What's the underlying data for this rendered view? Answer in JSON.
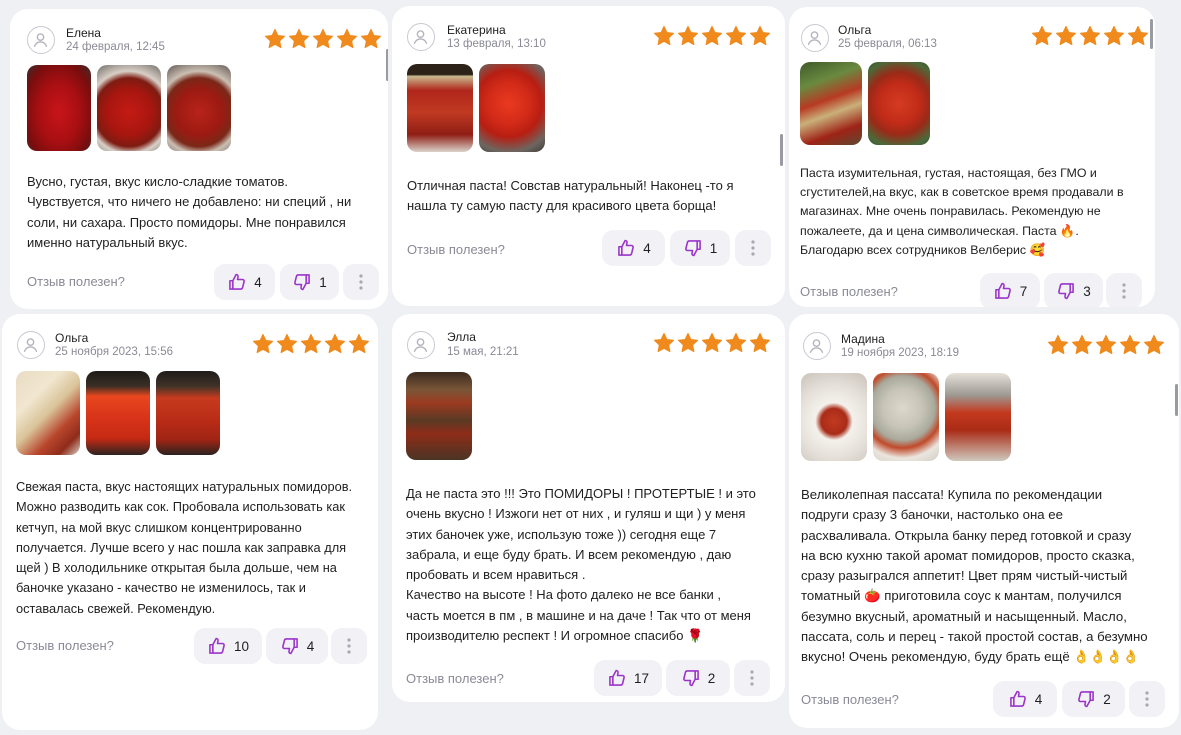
{
  "colors": {
    "star": "#f08a1d",
    "accent": "#9b34c9",
    "muted": "#8a8a96",
    "button_bg": "#f1f1f6"
  },
  "reviews": [
    {
      "name": "Елена",
      "date": "24 февраля, 12:45",
      "rating": 5,
      "photos": [
        "tomato-paste-spoon-photo",
        "paste-jar-open-photo",
        "paste-jar-open-photo"
      ],
      "text": "Вусно, густая, вкус кисло-сладкие томатов.\nЧувствуется, что ничего не добавлено: ни специй , ни\nсоли, ни сахара. Просто помидоры. Мне понравился\nименно натуральный вкус.",
      "helpful_label": "Отзыв полезен?",
      "likes": "4",
      "dislikes": "1"
    },
    {
      "name": "Екатерина",
      "date": "13 февраля, 13:10",
      "rating": 5,
      "photos": [
        "passata-jar-photo",
        "paste-jar-open-photo"
      ],
      "text": "Отличная паста! Совстав натуральный! Наконец -то я\nнашла ту самую пасту для красивого цвета борща!",
      "helpful_label": "Отзыв полезен?",
      "likes": "4",
      "dislikes": "1"
    },
    {
      "name": "Ольга",
      "date": "25 февраля, 06:13",
      "rating": 5,
      "photos": [
        "passata-jar-in-hand-photo",
        "paste-jar-open-photo"
      ],
      "text": "Паста изумительная, густая, настоящая, без ГМО и\nсгустителей,на вкус, как в советское время продавали в\nмагазинах. Мне очень понравилась. Рекомендую не\nпожалеете, да и цена символическая. Паста 🔥.\nБлагодарю всех сотрудников Велберис 🥰",
      "helpful_label": "Отзыв полезен?",
      "likes": "7",
      "dislikes": "3"
    },
    {
      "name": "Ольга",
      "date": "25 ноября 2023, 15:56",
      "rating": 5,
      "photos": [
        "pasta-dish-photo",
        "passata-jar-photo",
        "passata-jar-photo"
      ],
      "text": "Свежая паста, вкус настоящих натуральных помидоров.\nМожно разводить как сок. Пробовала использовать как\nкетчуп, на мой вкус слишком концентрированно\nполучается. Лучше всего у нас пошла как заправка для\nщей ) В холодильнике открытая была дольше, чем на\nбаночке указано - качество не изменилось, так и\nоставалась свежей. Рекомендую.",
      "helpful_label": "Отзыв полезен?",
      "likes": "10",
      "dislikes": "4"
    },
    {
      "name": "Элла",
      "date": "15 мая, 21:21",
      "rating": 5,
      "photos": [
        "jars-on-shelf-photo"
      ],
      "text": "Да не паста это !!! Это ПОМИДОРЫ ! ПРОТЕРТЫЕ ! и это\nочень вкусно ! Изжоги нет от них , и гуляш и щи ) у меня\nэтих баночек уже, использую тоже  )) сегодня еще 7\nзабрала, и еще буду брать. И всем рекомендую , даю\nпробовать и всем нравиться .\nКачество на высоте ! На фото далеко не все банки ,\nчасть моется в пм , в машине и на даче ! Так что от меня\nпроизводителю респект ! И огромное спасибо 🌹",
      "helpful_label": "Отзыв полезен?",
      "likes": "17",
      "dislikes": "2"
    },
    {
      "name": "Мадина",
      "date": "19 ноября 2023, 18:19",
      "rating": 5,
      "photos": [
        "sauce-bowl-photo",
        "manti-with-sauce-photo",
        "three-jars-photo"
      ],
      "text": "Великолепная пассата! Купила по рекомендации\nподруги сразу 3 баночки, настолько она ее\nрасхваливала. Открыла банку перед готовкой и сразу\nна всю кухню такой аромат помидоров, просто сказка,\nсразу разыгрался аппетит! Цвет прям чистый-чистый\nтоматный 🍅 приготовила соус к мантам, получился\nбезумно вкусный, ароматный и насыщенный. Масло,\nпассата, соль и перец - такой простой состав, а безумно\nвкусно! Очень рекомендую, буду брать ещё 👌👌👌👌",
      "helpful_label": "Отзыв полезен?",
      "likes": "4",
      "dislikes": "2"
    }
  ]
}
